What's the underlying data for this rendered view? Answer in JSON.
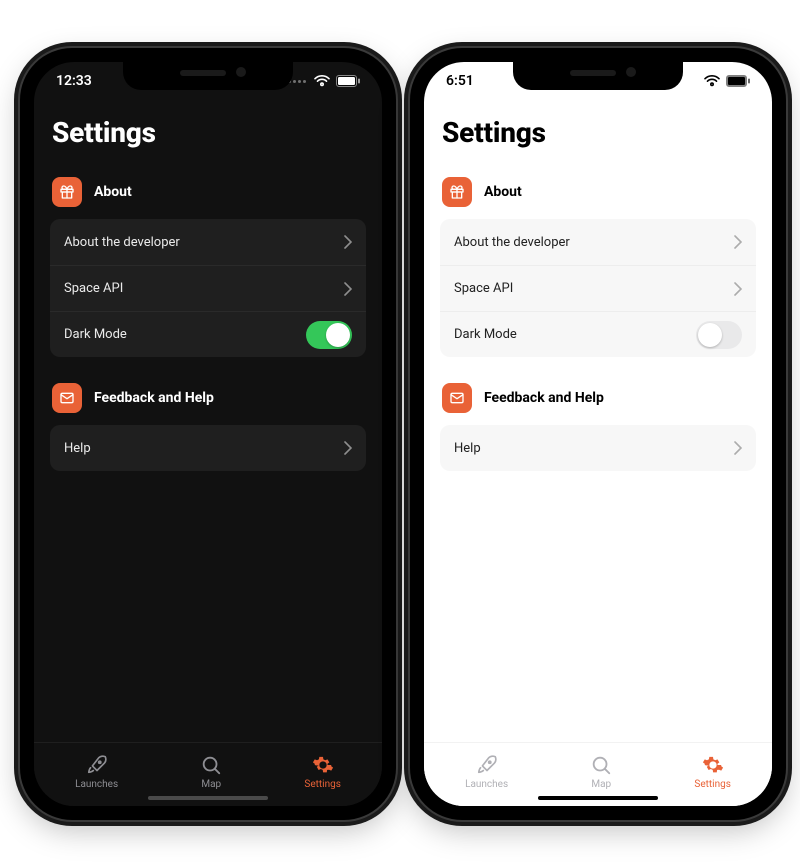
{
  "accent": "#E96237",
  "phones": {
    "dark": {
      "status_time": "12:33",
      "dark_mode_on": true
    },
    "light": {
      "status_time": "6:51",
      "dark_mode_on": false
    }
  },
  "page": {
    "title": "Settings",
    "sections": [
      {
        "icon": "gift-icon",
        "title": "About",
        "rows": [
          {
            "label": "About the developer",
            "type": "nav"
          },
          {
            "label": "Space API",
            "type": "nav"
          },
          {
            "label": "Dark Mode",
            "type": "toggle"
          }
        ]
      },
      {
        "icon": "mail-icon",
        "title": "Feedback and Help",
        "rows": [
          {
            "label": "Help",
            "type": "nav"
          }
        ]
      }
    ]
  },
  "tabs": [
    {
      "icon": "rocket-icon",
      "label": "Launches",
      "active": false
    },
    {
      "icon": "search-icon",
      "label": "Map",
      "active": false
    },
    {
      "icon": "gear-icon",
      "label": "Settings",
      "active": true
    }
  ]
}
